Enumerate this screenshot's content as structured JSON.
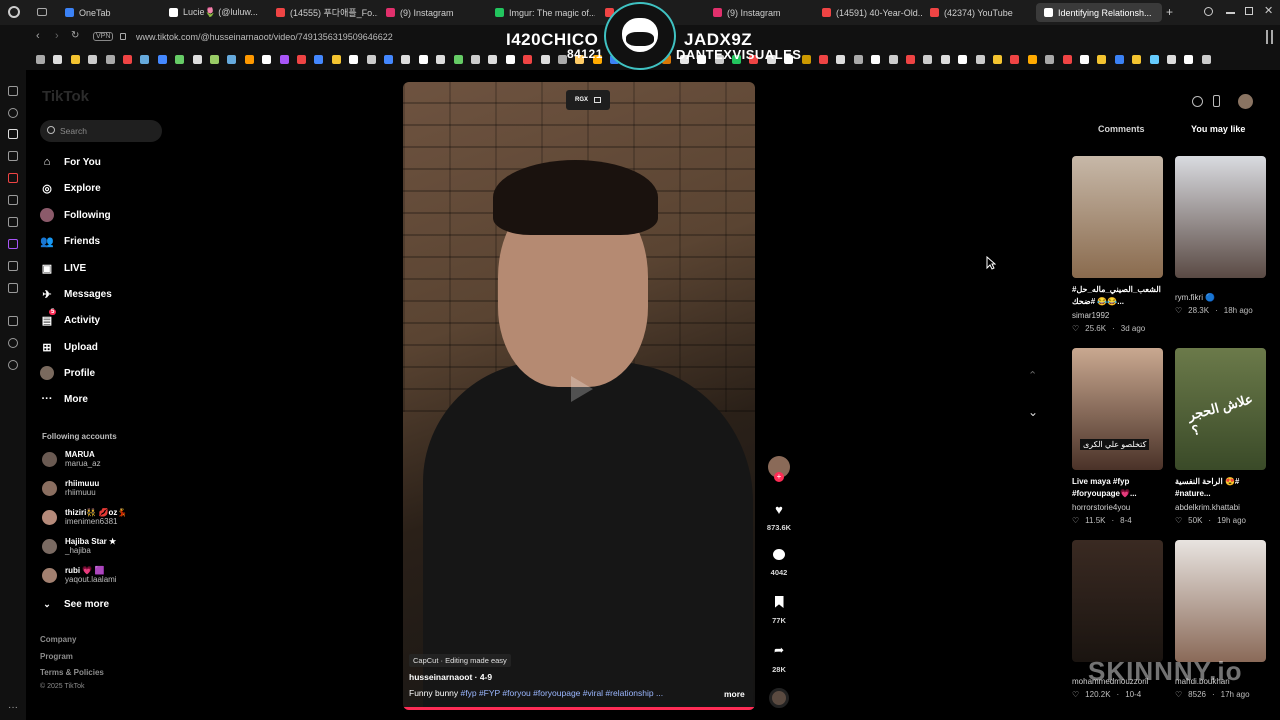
{
  "browser": {
    "tabs": [
      {
        "label": "OneTab",
        "color": "#3b82f6"
      },
      {
        "label": "Lucie🌷 (@luluw...",
        "color": "#ffffff"
      },
      {
        "label": "(14555) 푸다애플_Fo...",
        "color": "#ef4444"
      },
      {
        "label": "(9) Instagram",
        "color": "#e1306c"
      },
      {
        "label": "Imgur: The magic of...",
        "color": "#22c55e"
      },
      {
        "label": "Marrakech...",
        "color": "#ef4444"
      },
      {
        "label": "(9) Instagram",
        "color": "#e1306c"
      },
      {
        "label": "(14591) 40-Year-Old...",
        "color": "#ef4444"
      },
      {
        "label": "(42374) YouTube",
        "color": "#ef4444"
      },
      {
        "label": "Identifying Relationsh...",
        "color": "#ffffff"
      }
    ],
    "url": "www.tiktok.com/@husseinarnaoot/video/7491356319509646622",
    "vpn_label": "VPN"
  },
  "overlay": {
    "left_name": "I420CHICO",
    "left_num": "84121",
    "right_name": "JADX9Z",
    "right_sub": "DANTEXVISUALES",
    "watermark": "SKINNNY.io"
  },
  "sidebar": {
    "logo": "TikTok",
    "search_placeholder": "Search",
    "nav": [
      {
        "label": "For You",
        "icon": "home-icon"
      },
      {
        "label": "Explore",
        "icon": "compass-icon"
      },
      {
        "label": "Following",
        "icon": "following-icon"
      },
      {
        "label": "Friends",
        "icon": "friends-icon"
      },
      {
        "label": "LIVE",
        "icon": "live-icon"
      },
      {
        "label": "Messages",
        "icon": "messages-icon"
      },
      {
        "label": "Activity",
        "icon": "activity-icon",
        "badge": "5"
      },
      {
        "label": "Upload",
        "icon": "upload-icon"
      },
      {
        "label": "Profile",
        "icon": "profile-icon"
      },
      {
        "label": "More",
        "icon": "more-icon"
      }
    ],
    "following_title": "Following accounts",
    "following": [
      {
        "name": "MARUA",
        "handle": "marua_az"
      },
      {
        "name": "rhiimuuu",
        "handle": "rhiimuuu"
      },
      {
        "name": "thiziri👯 💋oz💃",
        "handle": "imenimen6381"
      },
      {
        "name": "Hajiba Star ★",
        "handle": "_hajiba"
      },
      {
        "name": "rubi 💗 🟪",
        "handle": "yaqout.laalami"
      }
    ],
    "see_more": "See more",
    "footer": [
      "Company",
      "Program",
      "Terms & Policies",
      "© 2025 TikTok"
    ]
  },
  "video": {
    "top_badge": "RGX",
    "capcut": "CapCut · Editing made easy",
    "author": "husseinarnaoot · 4-9",
    "caption": "Funny bunny",
    "hashtags": "#fyp  #FYP  #foryou  #foryoupage  #viral  #relationship ...",
    "more": "more",
    "likes": "873.6K",
    "comments": "4042",
    "saves": "77K",
    "shares": "28K"
  },
  "right_panel": {
    "tabs": [
      "Comments",
      "You may like"
    ],
    "cards": [
      {
        "title": "#الشعب_الصيني_ماله_حل #ضحك 😂😂...",
        "user": "simar1992",
        "likes": "25.6K",
        "time": "3d ago",
        "c1": "#c7b8a8",
        "c2": "#8a6b4e"
      },
      {
        "title": "",
        "user": "rym.fikri 🔵",
        "likes": "28.3K",
        "time": "18h ago",
        "c1": "#d9dbe0",
        "c2": "#5a4a44"
      },
      {
        "title": "Live maya #fyp #foryoupage💗...",
        "user": "horrorstorie4you",
        "likes": "11.5K",
        "time": "8-4",
        "c1": "#c9a890",
        "c2": "#4a3228"
      },
      {
        "title": "الراحة النفسية 😍# #nature...",
        "user": "abdelkrim.khattabi",
        "likes": "50K",
        "time": "19h ago",
        "c1": "#6b7a4a",
        "c2": "#3a4a28"
      },
      {
        "title": "",
        "user": "mohammedmouzzorii",
        "likes": "120.2K",
        "time": "10-4",
        "c1": "#3a2a22",
        "c2": "#1a1410"
      },
      {
        "title": "",
        "user": "mahdi.boukhari",
        "likes": "8526",
        "time": "17h ago",
        "c1": "#e8e4e0",
        "c2": "#8a6a58"
      }
    ],
    "card_overlays": [
      "كتخلصو علي الكرى",
      "علاش الحجر ؟"
    ]
  },
  "colors": {
    "accent": "#fe2c55",
    "hashtag": "#9bb7ff"
  }
}
